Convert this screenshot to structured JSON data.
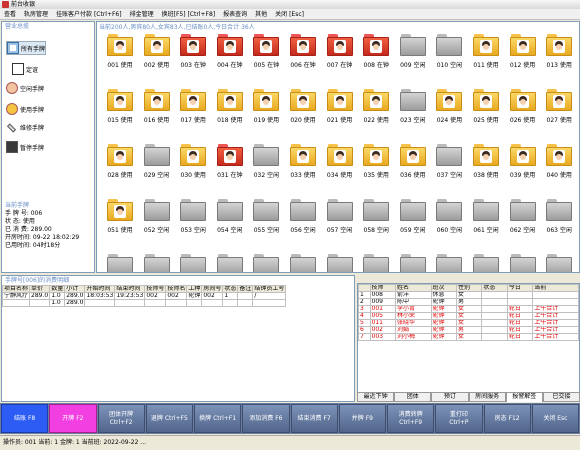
{
  "window": {
    "title": "前台收银"
  },
  "menu": [
    "查看",
    "轨房管理",
    "挂账客户付款 [Ctrl+F6]",
    "排金管理",
    "换班[F5] [Ctrl+F8]",
    "报表查询",
    "其他",
    "关闭 [Esc]"
  ],
  "left": {
    "section_title": "营业总揽",
    "tree": [
      {
        "label": "所有手牌",
        "icon": "book-icon"
      },
      {
        "label": "定谊",
        "icon": "table-icon"
      },
      {
        "label": "空闲手牌",
        "icon": "person-icon"
      },
      {
        "label": "使用手牌",
        "icon": "person-gold-icon"
      },
      {
        "label": "维修手牌",
        "icon": "wrench-icon"
      },
      {
        "label": "暂停手牌",
        "icon": "book-dark-icon"
      }
    ],
    "current_title": "当前手牌",
    "current": [
      "手 牌 号: 006",
      "状    态: 使用",
      "已 消 费: 289.00",
      "开房时间: 09-22 18:02:29",
      "已用时间: 04时18分"
    ]
  },
  "grid": {
    "title": "当前200人,男宾80人,女宾83人,已结账0人,今日合计 36人",
    "rooms": [
      {
        "label": "001 使用",
        "state": "using"
      },
      {
        "label": "002 使用",
        "state": "using"
      },
      {
        "label": "003 在钟",
        "state": "busy"
      },
      {
        "label": "004 在钟",
        "state": "busy"
      },
      {
        "label": "005 在钟",
        "state": "busy"
      },
      {
        "label": "006 在钟",
        "state": "busy"
      },
      {
        "label": "007 在钟",
        "state": "busy"
      },
      {
        "label": "008 在钟",
        "state": "busy"
      },
      {
        "label": "009 空闲",
        "state": "free"
      },
      {
        "label": "010 空闲",
        "state": "free"
      },
      {
        "label": "011 使用",
        "state": "using"
      },
      {
        "label": "012 使用",
        "state": "using"
      },
      {
        "label": "013 使用",
        "state": "using"
      },
      {
        "label": "015 使用",
        "state": "using"
      },
      {
        "label": "016 使用",
        "state": "using"
      },
      {
        "label": "017 使用",
        "state": "using"
      },
      {
        "label": "018 使用",
        "state": "using"
      },
      {
        "label": "019 使用",
        "state": "using"
      },
      {
        "label": "020 使用",
        "state": "using"
      },
      {
        "label": "021 使用",
        "state": "using"
      },
      {
        "label": "022 使用",
        "state": "using"
      },
      {
        "label": "023 空闲",
        "state": "free"
      },
      {
        "label": "024 使用",
        "state": "using"
      },
      {
        "label": "025 使用",
        "state": "using"
      },
      {
        "label": "026 使用",
        "state": "using"
      },
      {
        "label": "027 使用",
        "state": "using"
      },
      {
        "label": "028 使用",
        "state": "using"
      },
      {
        "label": "029 空闲",
        "state": "free"
      },
      {
        "label": "030 使用",
        "state": "using"
      },
      {
        "label": "031 在钟",
        "state": "busy"
      },
      {
        "label": "032 空闲",
        "state": "free"
      },
      {
        "label": "033 使用",
        "state": "using"
      },
      {
        "label": "034 使用",
        "state": "using"
      },
      {
        "label": "035 使用",
        "state": "using"
      },
      {
        "label": "036 使用",
        "state": "using"
      },
      {
        "label": "037 空闲",
        "state": "free"
      },
      {
        "label": "038 使用",
        "state": "using"
      },
      {
        "label": "039 使用",
        "state": "using"
      },
      {
        "label": "040 使用",
        "state": "using"
      },
      {
        "label": "051 使用",
        "state": "using"
      },
      {
        "label": "052 空闲",
        "state": "free"
      },
      {
        "label": "053 空闲",
        "state": "free"
      },
      {
        "label": "054 空闲",
        "state": "free"
      },
      {
        "label": "055 空闲",
        "state": "free"
      },
      {
        "label": "056 空闲",
        "state": "free"
      },
      {
        "label": "057 空闲",
        "state": "free"
      },
      {
        "label": "058 空闲",
        "state": "free"
      },
      {
        "label": "059 空闲",
        "state": "free"
      },
      {
        "label": "060 空闲",
        "state": "free"
      },
      {
        "label": "061 空闲",
        "state": "free"
      },
      {
        "label": "062 空闲",
        "state": "free"
      },
      {
        "label": "063 空闲",
        "state": "free"
      },
      {
        "label": "",
        "state": "free"
      },
      {
        "label": "",
        "state": "free"
      },
      {
        "label": "",
        "state": "free"
      },
      {
        "label": "",
        "state": "free"
      },
      {
        "label": "",
        "state": "free"
      },
      {
        "label": "",
        "state": "free"
      },
      {
        "label": "",
        "state": "free"
      },
      {
        "label": "",
        "state": "free"
      },
      {
        "label": "",
        "state": "free"
      },
      {
        "label": "",
        "state": "free"
      },
      {
        "label": "",
        "state": "free"
      },
      {
        "label": "",
        "state": "free"
      },
      {
        "label": "",
        "state": "free"
      }
    ]
  },
  "consume": {
    "title": "手牌号[006]的消费明细",
    "headers": [
      "项目名称",
      "单价",
      "数量",
      "小计",
      "开始时间",
      "结束时间",
      "技师号",
      "技师名",
      "工种",
      "房间号",
      "状态",
      "备注",
      "结钟员工号"
    ],
    "rows": [
      [
        "宁静风疗",
        "289.0",
        "1.0",
        "289.0",
        "18:03:53",
        "19:23:53",
        "002",
        "002",
        "轮钟",
        "002",
        "1",
        "",
        "/"
      ],
      [
        "",
        "",
        "1.0",
        "289.0",
        "",
        "",
        "",
        "",
        "",
        "",
        "",
        "",
        ""
      ]
    ]
  },
  "staff": {
    "headers": [
      "",
      "技师",
      "姓名",
      "班次",
      "性别",
      "状态",
      "今日",
      "当前"
    ],
    "rows": [
      {
        "cells": [
          "1",
          "008",
          "俞洋",
          "休息",
          "女",
          "",
          "",
          ""
        ],
        "red": false
      },
      {
        "cells": [
          "2",
          "009",
          "陈中",
          "轮钟",
          "男",
          "",
          "",
          ""
        ],
        "red": false
      },
      {
        "cells": [
          "3",
          "001",
          "李小青",
          "轮钟",
          "女",
          "",
          "轮日",
          "上午合计"
        ],
        "red": true
      },
      {
        "cells": [
          "4",
          "005",
          "林小荣",
          "轮钟",
          "女",
          "",
          "轮日",
          "上午合计"
        ],
        "red": true
      },
      {
        "cells": [
          "5",
          "011",
          "张晓华",
          "轮钟",
          "女",
          "",
          "轮日",
          "上午合计"
        ],
        "red": true
      },
      {
        "cells": [
          "6",
          "002",
          "刘娟",
          "轮钟",
          "男",
          "",
          "轮日",
          "上午合计"
        ],
        "red": true
      },
      {
        "cells": [
          "7",
          "003",
          "刘小梅",
          "轮钟",
          "女",
          "",
          "轮日",
          "上午合计"
        ],
        "red": true
      }
    ],
    "tabs": [
      "最近下钟",
      "团体",
      "预订",
      "房间服务",
      "报警解签",
      "已交接"
    ]
  },
  "toolbar": [
    {
      "label": "结账 F8",
      "style": "blue"
    },
    {
      "label": "开牌 F2",
      "style": "pink"
    },
    {
      "label": "团体开牌\nCtrl+F2",
      "style": ""
    },
    {
      "label": "退牌 Ctrl+F5",
      "style": ""
    },
    {
      "label": "换牌 Ctrl+F1",
      "style": ""
    },
    {
      "label": "添加消费 F6",
      "style": ""
    },
    {
      "label": "结束消费 F7",
      "style": ""
    },
    {
      "label": "并牌 F9",
      "style": ""
    },
    {
      "label": "消费转牌\nCtrl+F9",
      "style": ""
    },
    {
      "label": "重打印\nCtrl+P",
      "style": ""
    },
    {
      "label": "房态 F12",
      "style": ""
    },
    {
      "label": "关闭 Esc",
      "style": ""
    }
  ],
  "status": "操作员: 001    当前: 1    金牌: 1    当前班: 2022-09-22 ..."
}
